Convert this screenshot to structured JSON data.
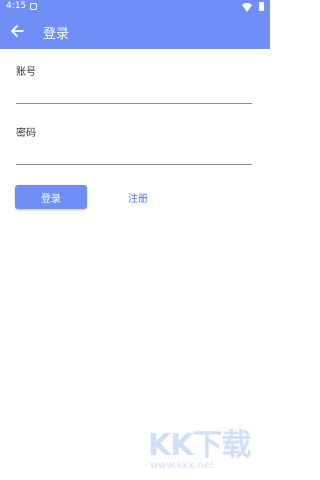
{
  "status_bar": {
    "time": "4:15"
  },
  "app_bar": {
    "title": "登录",
    "back_icon": "arrow-left-icon"
  },
  "form": {
    "account_label": "账号",
    "account_value": "",
    "password_label": "密码",
    "password_value": "",
    "login_button": "登录",
    "register_link": "注册"
  },
  "watermark": {
    "brand": "KK下载",
    "url": "www.kkx.net"
  },
  "colors": {
    "primary": "#6f8ff7",
    "link": "#4a78f0",
    "background": "#ffffff"
  }
}
